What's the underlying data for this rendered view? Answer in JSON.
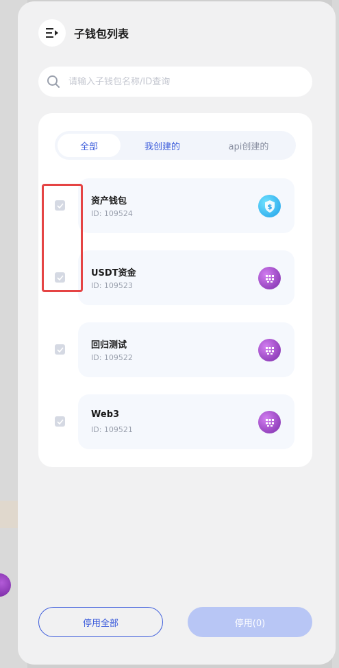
{
  "title": "子钱包列表",
  "search": {
    "placeholder": "请输入子钱包名称/ID查询",
    "value": ""
  },
  "tabs": [
    {
      "label": "全部",
      "active": true
    },
    {
      "label": "我创建的",
      "active": false
    },
    {
      "label": "api创建的",
      "active": false
    }
  ],
  "wallets": [
    {
      "name": "资产钱包",
      "id": "ID: 109524",
      "icon": "shield-dollar-icon",
      "checked": true
    },
    {
      "name": "USDT资金",
      "id": "ID: 109523",
      "icon": "grid-dots-icon",
      "checked": true
    },
    {
      "name": "回归测试",
      "id": "ID: 109522",
      "icon": "grid-dots-icon",
      "checked": true
    },
    {
      "name": "Web3",
      "id": "ID: 109521",
      "icon": "grid-dots-icon",
      "checked": true
    }
  ],
  "footer": {
    "disable_all_label": "停用全部",
    "disable_label": "停用(0)"
  },
  "colors": {
    "accent": "#3b5bdb",
    "highlight": "#e54444",
    "disabled_button": "#b8c6f5"
  }
}
